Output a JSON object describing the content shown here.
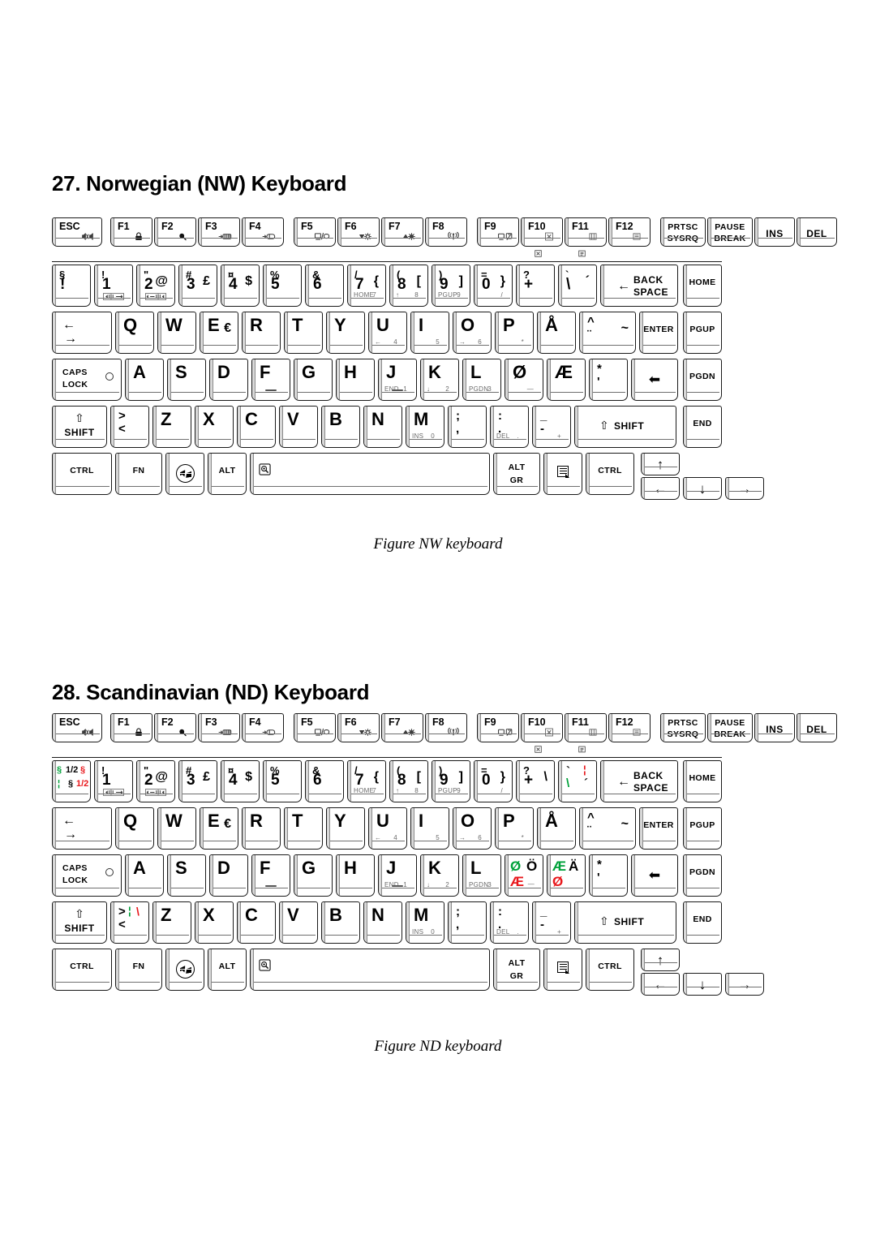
{
  "document": {
    "sections": [
      {
        "id": "nw",
        "title": "27. Norwegian (NW) Keyboard",
        "caption": "Figure NW keyboard"
      },
      {
        "id": "nd",
        "title": "28. Scandinavian (ND) Keyboard",
        "caption": "Figure ND keyboard"
      }
    ]
  },
  "colors": {
    "green": "#00a13a",
    "red": "#e8181c",
    "key_outline": "#1a1a1a",
    "key_face": "#ffffff",
    "sublabel_gray": "#6a6a6a"
  },
  "nw_keyboard": {
    "function_row": [
      {
        "top": "ESC",
        "icon": "mute-speaker-icon"
      },
      {
        "top": "F1",
        "icon": "lock-icon"
      },
      {
        "top": "F2",
        "icon": "magnifier-icon"
      },
      {
        "top": "F3",
        "icon": "sleep-icon"
      },
      {
        "top": "F4",
        "icon": "hibernate-icon"
      },
      {
        "top": "F5",
        "icon": "display-switch-icon"
      },
      {
        "top": "F6",
        "icon": "brightness-down-icon"
      },
      {
        "top": "F7",
        "icon": "brightness-up-icon"
      },
      {
        "top": "F8",
        "icon": "wireless-icon"
      },
      {
        "top": "F9",
        "icon": "touchpad-icon"
      },
      {
        "top": "F10",
        "icon": "cursor-mode-icon"
      },
      {
        "top": "F11",
        "icon": "numlock-icon"
      },
      {
        "top": "F12",
        "icon": "scrolllock-icon"
      },
      {
        "top": "PRTSC",
        "bottom": "SYSRQ"
      },
      {
        "top": "PAUSE",
        "bottom": "BREAK"
      },
      {
        "center": "INS"
      },
      {
        "center": "DEL"
      }
    ],
    "fn_hints": [
      "cursor-mode-hint-icon",
      "numlock-hint-icon"
    ],
    "number_row": [
      {
        "tl": "§",
        "big": "!",
        "note": "section-key"
      },
      {
        "tl": "!",
        "big": "1",
        "sub_icon": "vol-down-icon"
      },
      {
        "tl": "\"",
        "big": "2",
        "tr": "@",
        "sub_icon": "vol-up-icon"
      },
      {
        "tl": "#",
        "big": "3",
        "tr": "£"
      },
      {
        "tl": "¤",
        "big": "4",
        "tr": "$"
      },
      {
        "tl": "%",
        "big": "5"
      },
      {
        "tl": "&",
        "big": "6"
      },
      {
        "tl": "/",
        "big": "7",
        "tr": "{",
        "sub_left": "HOME",
        "sub_right": "7"
      },
      {
        "tl": "(",
        "big": "8",
        "tr": "[",
        "sub_left": "↑",
        "sub_right": "8"
      },
      {
        "tl": ")",
        "big": "9",
        "tr": "]",
        "sub_left": "PGUP",
        "sub_right": "9"
      },
      {
        "tl": "=",
        "big": "0",
        "tr": "}",
        "sub_right": "/"
      },
      {
        "tl": "?",
        "big": "+"
      },
      {
        "tl": "`",
        "big": "\\",
        "tr": "´"
      },
      {
        "center": "BACK SPACE",
        "icon": "backspace-arrow-icon"
      },
      {
        "center": "HOME"
      }
    ],
    "qwerty_row": [
      {
        "center": "TAB",
        "icon": "tab-arrows-icon"
      },
      {
        "alpha": "Q"
      },
      {
        "alpha": "W"
      },
      {
        "alpha": "E",
        "tr": "€"
      },
      {
        "alpha": "R"
      },
      {
        "alpha": "T"
      },
      {
        "alpha": "Y"
      },
      {
        "alpha": "U",
        "sub_left": "←",
        "sub_right": "4"
      },
      {
        "alpha": "I",
        "sub_right": "5"
      },
      {
        "alpha": "O",
        "sub_left": "→",
        "sub_right": "6"
      },
      {
        "alpha": "P",
        "sub_right": "*"
      },
      {
        "alpha": "Å"
      },
      {
        "tl": "^",
        "bl": "¨",
        "tr": "~"
      },
      {
        "center": "ENTER"
      },
      {
        "center": "PGUP"
      }
    ],
    "home_row": [
      {
        "center": "CAPS LOCK",
        "led": true
      },
      {
        "alpha": "A"
      },
      {
        "alpha": "S"
      },
      {
        "alpha": "D"
      },
      {
        "alpha": "F",
        "bump": true
      },
      {
        "alpha": "G"
      },
      {
        "alpha": "H"
      },
      {
        "alpha": "J",
        "sub_left": "END",
        "sub_right": "1",
        "bump": true
      },
      {
        "alpha": "K",
        "sub_left": "↓",
        "sub_right": "2"
      },
      {
        "alpha": "L",
        "sub_left": "PGDN",
        "sub_right": "3"
      },
      {
        "alpha": "Ø",
        "sub_right": "—"
      },
      {
        "alpha": "Æ"
      },
      {
        "tl": "*",
        "bl": "'"
      },
      {
        "center": "ENTER",
        "icon": "enter-arrow-icon"
      },
      {
        "center": "PGDN"
      }
    ],
    "shift_row": [
      {
        "center": "SHIFT",
        "icon": "shift-arrow-icon"
      },
      {
        "tl": ">",
        "bl": "<"
      },
      {
        "alpha": "Z"
      },
      {
        "alpha": "X"
      },
      {
        "alpha": "C"
      },
      {
        "alpha": "V"
      },
      {
        "alpha": "B"
      },
      {
        "alpha": "N"
      },
      {
        "alpha": "M",
        "sub_left": "INS",
        "sub_right": "0"
      },
      {
        "tl": ";",
        "bl": ","
      },
      {
        "tl": ":",
        "bl": ".",
        "sub_left": "DEL",
        "sub_right": "."
      },
      {
        "tl": "_",
        "bl": "-",
        "sub_right": "+"
      },
      {
        "center": "SHIFT",
        "icon": "shift-arrow-icon"
      },
      {
        "center": "END"
      }
    ],
    "bottom_row": [
      {
        "center": "CTRL"
      },
      {
        "center": "FN"
      },
      {
        "icon": "windows-logo-icon"
      },
      {
        "center": "ALT"
      },
      {
        "icon": "zoom-magnifier-icon",
        "space": true
      },
      {
        "top": "ALT",
        "bottom": "GR"
      },
      {
        "icon": "application-menu-icon"
      },
      {
        "center": "CTRL"
      },
      {
        "icon": "arrow-up-icon"
      },
      {
        "icon": "arrow-left-icon"
      },
      {
        "icon": "arrow-down-icon"
      },
      {
        "icon": "arrow-right-icon"
      }
    ]
  },
  "nd_keyboard": {
    "function_row": [
      {
        "top": "ESC",
        "icon": "mute-speaker-icon"
      },
      {
        "top": "F1",
        "icon": "lock-icon"
      },
      {
        "top": "F2",
        "icon": "magnifier-icon"
      },
      {
        "top": "F3",
        "icon": "sleep-icon"
      },
      {
        "top": "F4",
        "icon": "hibernate-icon"
      },
      {
        "top": "F5",
        "icon": "display-switch-icon"
      },
      {
        "top": "F6",
        "icon": "brightness-down-icon"
      },
      {
        "top": "F7",
        "icon": "brightness-up-icon"
      },
      {
        "top": "F8",
        "icon": "wireless-icon"
      },
      {
        "top": "F9",
        "icon": "touchpad-icon"
      },
      {
        "top": "F10",
        "icon": "cursor-mode-icon"
      },
      {
        "top": "F11",
        "icon": "numlock-icon"
      },
      {
        "top": "F12",
        "icon": "scrolllock-icon"
      },
      {
        "top": "PRTSC",
        "bottom": "SYSRQ"
      },
      {
        "top": "PAUSE",
        "bottom": "BREAK"
      },
      {
        "center": "INS"
      },
      {
        "center": "DEL"
      }
    ],
    "fn_hints": [
      "cursor-mode-hint-icon",
      "numlock-hint-icon"
    ],
    "number_row": [
      {
        "multi": true,
        "tl_green": "§",
        "tl_black": "1/2",
        "tl_red": "§",
        "bl_green": "¦",
        "bl_black": "§",
        "bl_red": "1/2"
      },
      {
        "tl": "!",
        "big": "1",
        "sub_icon": "vol-down-icon"
      },
      {
        "tl": "\"",
        "big": "2",
        "tr": "@",
        "sub_icon": "vol-up-icon"
      },
      {
        "tl": "#",
        "big": "3",
        "tr": "£"
      },
      {
        "tl": "¤",
        "big": "4",
        "tr": "$"
      },
      {
        "tl": "%",
        "big": "5"
      },
      {
        "tl": "&",
        "big": "6"
      },
      {
        "tl": "/",
        "big": "7",
        "tr": "{",
        "sub_left": "HOME",
        "sub_right": "7"
      },
      {
        "tl": "(",
        "big": "8",
        "tr": "[",
        "sub_left": "↑",
        "sub_right": "8"
      },
      {
        "tl": ")",
        "big": "9",
        "tr": "]",
        "sub_left": "PGUP",
        "sub_right": "9"
      },
      {
        "tl": "=",
        "big": "0",
        "tr": "}",
        "sub_right": "/"
      },
      {
        "tl": "?",
        "big": "+",
        "tr": "\\"
      },
      {
        "accent": true,
        "tl": "`",
        "tl_red": "¦",
        "bl_green": "\\",
        "bl_black": "´"
      },
      {
        "center": "BACK SPACE",
        "icon": "backspace-arrow-icon"
      },
      {
        "center": "HOME"
      }
    ],
    "qwerty_row": [
      {
        "center": "TAB",
        "icon": "tab-arrows-icon"
      },
      {
        "alpha": "Q"
      },
      {
        "alpha": "W"
      },
      {
        "alpha": "E",
        "tr": "€"
      },
      {
        "alpha": "R"
      },
      {
        "alpha": "T"
      },
      {
        "alpha": "Y"
      },
      {
        "alpha": "U",
        "sub_left": "←",
        "sub_right": "4"
      },
      {
        "alpha": "I",
        "sub_right": "5"
      },
      {
        "alpha": "O",
        "sub_left": "→",
        "sub_right": "6"
      },
      {
        "alpha": "P",
        "sub_right": "*"
      },
      {
        "alpha": "Å"
      },
      {
        "tl": "^",
        "bl": "¨",
        "tr": "~"
      },
      {
        "center": "ENTER"
      },
      {
        "center": "PGUP"
      }
    ],
    "home_row": [
      {
        "center": "CAPS LOCK",
        "led": true
      },
      {
        "alpha": "A"
      },
      {
        "alpha": "S"
      },
      {
        "alpha": "D"
      },
      {
        "alpha": "F",
        "bump": true
      },
      {
        "alpha": "G"
      },
      {
        "alpha": "H"
      },
      {
        "alpha": "J",
        "sub_left": "END",
        "sub_right": "1",
        "bump": true
      },
      {
        "alpha": "K",
        "sub_left": "↓",
        "sub_right": "2"
      },
      {
        "alpha": "L",
        "sub_left": "PGDN",
        "sub_right": "3"
      },
      {
        "multi2": true,
        "tl_green": "Ø",
        "tl_black": "Ö",
        "bl_red": "Æ",
        "sub_right": "—"
      },
      {
        "multi2": true,
        "tl_green": "Æ",
        "tl_black": "Ä",
        "bl_red": "Ø"
      },
      {
        "tl": "*",
        "bl": "'"
      },
      {
        "center": "ENTER",
        "icon": "enter-arrow-icon"
      },
      {
        "center": "PGDN"
      }
    ],
    "shift_row": [
      {
        "center": "SHIFT",
        "icon": "shift-arrow-icon"
      },
      {
        "tl": ">",
        "tl_green": "¦",
        "tl_red": "\\",
        "bl": "<"
      },
      {
        "alpha": "Z"
      },
      {
        "alpha": "X"
      },
      {
        "alpha": "C"
      },
      {
        "alpha": "V"
      },
      {
        "alpha": "B"
      },
      {
        "alpha": "N"
      },
      {
        "alpha": "M",
        "sub_left": "INS",
        "sub_right": "0"
      },
      {
        "tl": ";",
        "bl": ","
      },
      {
        "tl": ":",
        "bl": ".",
        "sub_left": "DEL",
        "sub_right": "."
      },
      {
        "tl": "_",
        "bl": "-",
        "sub_right": "+"
      },
      {
        "center": "SHIFT",
        "icon": "shift-arrow-icon"
      },
      {
        "center": "END"
      }
    ],
    "bottom_row": [
      {
        "center": "CTRL"
      },
      {
        "center": "FN"
      },
      {
        "icon": "windows-logo-icon"
      },
      {
        "center": "ALT"
      },
      {
        "icon": "zoom-magnifier-icon",
        "space": true
      },
      {
        "top": "ALT",
        "bottom": "GR"
      },
      {
        "icon": "application-menu-icon"
      },
      {
        "center": "CTRL"
      },
      {
        "icon": "arrow-up-icon"
      },
      {
        "icon": "arrow-left-icon"
      },
      {
        "icon": "arrow-down-icon"
      },
      {
        "icon": "arrow-right-icon"
      }
    ]
  }
}
